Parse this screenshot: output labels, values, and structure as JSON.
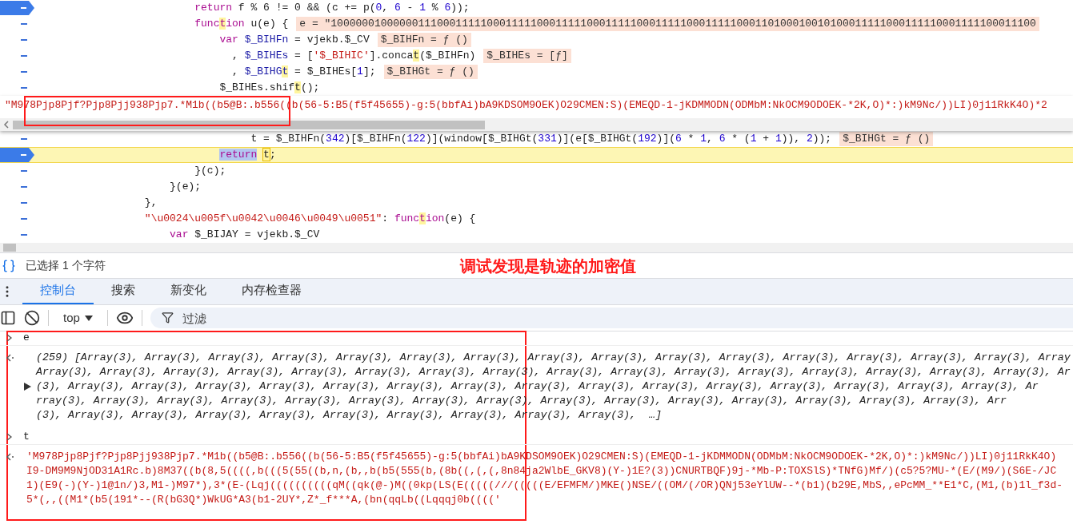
{
  "editor": {
    "lines": [
      {
        "kind": "code",
        "breakpoint": true,
        "paused": false,
        "segments": [
          {
            "text": "                        return",
            "kind": "kw"
          },
          {
            "text": " f % 6 != 0 && (c += p(",
            "kind": "plain"
          },
          {
            "text": "0",
            "kind": "num"
          },
          {
            "text": ", ",
            "kind": "plain"
          },
          {
            "text": "6",
            "kind": "num"
          },
          {
            "text": " - ",
            "kind": "plain"
          },
          {
            "text": "1",
            "kind": "num"
          },
          {
            "text": " % ",
            "kind": "plain"
          },
          {
            "text": "6",
            "kind": "num"
          },
          {
            "text": "));",
            "kind": "plain"
          }
        ]
      },
      {
        "kind": "code",
        "breakpoint": false,
        "paused": false,
        "segments": [
          {
            "text": "                        func",
            "kind": "kw"
          },
          {
            "text": "t",
            "kind": "matchkw"
          },
          {
            "text": "ion",
            "kind": "kw"
          },
          {
            "text": " u(e) {",
            "kind": "plain"
          }
        ],
        "value": "e = \"10000001000000111000111110001111100011111000111110001111100011111000110100010010100011111000111110001111100011100"
      },
      {
        "kind": "code",
        "breakpoint": false,
        "paused": false,
        "segments": [
          {
            "text": "                            var ",
            "kind": "kw"
          },
          {
            "text": "$_BIHFn",
            "kind": "var"
          },
          {
            "text": " = vjekb.$_CV",
            "kind": "plain"
          }
        ],
        "value": "$_BIHFn = ƒ ()"
      },
      {
        "kind": "code",
        "breakpoint": false,
        "paused": false,
        "segments": [
          {
            "text": "                              , ",
            "kind": "plain"
          },
          {
            "text": "$_BIHEs",
            "kind": "var"
          },
          {
            "text": " = [",
            "kind": "plain"
          },
          {
            "text": "'$_BIHIC'",
            "kind": "str"
          },
          {
            "text": "].conca",
            "kind": "plain"
          },
          {
            "text": "t",
            "kind": "match"
          },
          {
            "text": "($_BIHFn)",
            "kind": "plain"
          }
        ],
        "value": "$_BIHEs = [ƒ]"
      },
      {
        "kind": "code",
        "breakpoint": false,
        "paused": false,
        "segments": [
          {
            "text": "                              , ",
            "kind": "plain"
          },
          {
            "text": "$_BIHG",
            "kind": "var"
          },
          {
            "text": "t",
            "kind": "matchvar"
          },
          {
            "text": " = $_BIHEs[",
            "kind": "plain"
          },
          {
            "text": "1",
            "kind": "num"
          },
          {
            "text": "];",
            "kind": "plain"
          }
        ],
        "value": "$_BIHGt = ƒ ()"
      },
      {
        "kind": "code",
        "breakpoint": false,
        "paused": false,
        "segments": [
          {
            "text": "                            $_BIHEs.shif",
            "kind": "plain"
          },
          {
            "text": "t",
            "kind": "match"
          },
          {
            "text": "();",
            "kind": "plain"
          }
        ]
      },
      {
        "kind": "tooltip",
        "text": "\"M978Pjp8Pjf?Pjp8Pjj938Pjp7.*M1b((b5@B:.b556((b(56-5:B5(f5f45655)-g:5(bbfAi)bA9KDSOM9OEK)O29CMEN:S)(EMEQD-1-jKDMMODN(ODMbM:NkOCM9ODOEK-*2K,O)*:)kM9Nc/))LI)0j11RkK4O)*2"
      },
      {
        "kind": "code",
        "breakpoint": false,
        "paused": false,
        "segments": [
          {
            "text": "                                 t = $_BIHFn(",
            "kind": "plain"
          },
          {
            "text": "342",
            "kind": "num"
          },
          {
            "text": ")[$_BIHFn(",
            "kind": "plain"
          },
          {
            "text": "122",
            "kind": "num"
          },
          {
            "text": ")](window[$_BIHGt(",
            "kind": "plain"
          },
          {
            "text": "331",
            "kind": "num"
          },
          {
            "text": ")](e[$_BIHGt(",
            "kind": "plain"
          },
          {
            "text": "192",
            "kind": "num"
          },
          {
            "text": ")](",
            "kind": "plain"
          },
          {
            "text": "6",
            "kind": "num"
          },
          {
            "text": " * ",
            "kind": "plain"
          },
          {
            "text": "1",
            "kind": "num"
          },
          {
            "text": ", ",
            "kind": "plain"
          },
          {
            "text": "6",
            "kind": "num"
          },
          {
            "text": " * (",
            "kind": "plain"
          },
          {
            "text": "1",
            "kind": "num"
          },
          {
            "text": " + ",
            "kind": "plain"
          },
          {
            "text": "1",
            "kind": "num"
          },
          {
            "text": ")), ",
            "kind": "plain"
          },
          {
            "text": "2",
            "kind": "num"
          },
          {
            "text": "));",
            "kind": "plain"
          }
        ],
        "value": "$_BIHGt = ƒ ()"
      },
      {
        "kind": "code",
        "breakpoint": true,
        "paused": true,
        "segments": [
          {
            "text": "                            return",
            "kind": "sel"
          },
          {
            "text": " t",
            "kind": "boxed"
          },
          {
            "text": ";",
            "kind": "plain"
          }
        ]
      },
      {
        "kind": "code",
        "breakpoint": false,
        "paused": false,
        "segments": [
          {
            "text": "                        }(c);",
            "kind": "plain"
          }
        ]
      },
      {
        "kind": "code",
        "breakpoint": false,
        "paused": false,
        "segments": [
          {
            "text": "                    }(e);",
            "kind": "plain"
          }
        ]
      },
      {
        "kind": "code",
        "breakpoint": false,
        "paused": false,
        "segments": [
          {
            "text": "                },",
            "kind": "plain"
          }
        ]
      },
      {
        "kind": "code",
        "breakpoint": false,
        "paused": false,
        "segments": [
          {
            "text": "                \"\\u0024\\u005f\\u0042\\u0046\\u0049\\u0051\"",
            "kind": "str"
          },
          {
            "text": ": ",
            "kind": "plain"
          },
          {
            "text": "func",
            "kind": "kw"
          },
          {
            "text": "t",
            "kind": "matchkw"
          },
          {
            "text": "ion",
            "kind": "kw"
          },
          {
            "text": "(e) {",
            "kind": "plain"
          }
        ]
      },
      {
        "kind": "code",
        "breakpoint": false,
        "paused": false,
        "segments": [
          {
            "text": "                    var",
            "kind": "kw"
          },
          {
            "text": " $_BIJAY = vjekb.$_CV",
            "kind": "plain"
          }
        ]
      }
    ]
  },
  "status_bar": {
    "text": "已选择 1 个字符"
  },
  "annotation": {
    "text": "调试发现是轨迹的加密值"
  },
  "tabs": [
    {
      "label": "控制台",
      "selected": true
    },
    {
      "label": "搜索",
      "selected": false
    },
    {
      "label": "新变化",
      "selected": false
    },
    {
      "label": "内存检查器",
      "selected": false
    }
  ],
  "console_toolbar": {
    "context": "top",
    "filter_placeholder": "过滤"
  },
  "console": {
    "entries": [
      {
        "kind": "input",
        "text": "e"
      },
      {
        "kind": "array_output",
        "expanded": false,
        "lines": [
          "(259) [Array(3), Array(3), Array(3), Array(3), Array(3), Array(3), Array(3), Array(3), Array(3), Array(3), Array(3), Array(3), Array(3), Array(3), Array(3), Array",
          "Array(3), Array(3), Array(3), Array(3), Array(3), Array(3), Array(3), Array(3), Array(3), Array(3), Array(3), Array(3), Array(3), Array(3), Array(3), Array(3), Ar",
          "(3), Array(3), Array(3), Array(3), Array(3), Array(3), Array(3), Array(3), Array(3), Array(3), Array(3), Array(3), Array(3), Array(3), Array(3), Array(3), Ar",
          "rray(3), Array(3), Array(3), Array(3), Array(3), Array(3), Array(3), Array(3), Array(3), Array(3), Array(3), Array(3), Array(3), Array(3), Array(3), Arr",
          "(3), Array(3), Array(3), Array(3), Array(3), Array(3), Array(3), Array(3), Array(3), Array(3),  …]"
        ]
      },
      {
        "kind": "input",
        "text": "t"
      },
      {
        "kind": "string_output",
        "lines": [
          "'M978Pjp8Pjf?Pjp8Pjj938Pjp7.*M1b((b5@B:.b556((b(56-5:B5(f5f45655)-g:5(bbfAi)bA9KDSOM9OEK)O29CMEN:S)(EMEQD-1-jKDMMODN(ODMbM:NkOCM9ODOEK-*2K,O)*:)kM9Nc/))LI)0j11RkK4O)",
          "I9-DM9M9NjOD31A1Rc.b)8M37((b(8,5((((,b(((5(55((b,n,(b,,b(b5(555(b,(8b((,(,(,8n84ja2WlbE_GKV8)(Y-)1E?(3))CNURTBQF)9j-*Mb-P:TOXSlS)*TNfG)Mf/)(c5?5?MU-*(E/(M9/)(S6E-/JC",
          "1)(E9(-)(Y-)1@1n/)3,M1-)M97*),3*(E-(Lqj((((((((((qM((qk(@-)M((0kp(LS(E(((((///(((((E/EFMFM/)MKE()NSE/((OM/(/OR)QNj53eYlUW--*(b1)(b29E,MbS,,ePcMM_**E1*C,(M1,(b)1l_f3d-",
          "5*(,,((M1*(b5(191*--(R(bG3Q*)WkUG*A3(b1-2UY*,Z*_f***A,(bn(qqLb((Lqqqj0b(((('"
        ]
      }
    ]
  }
}
